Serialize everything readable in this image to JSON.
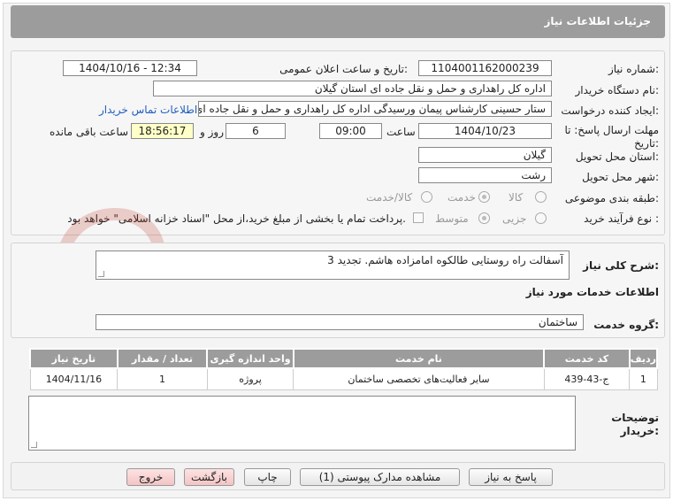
{
  "header": {
    "title": "جزئیات اطلاعات نیاز"
  },
  "form": {
    "need_number_label": "شماره نیاز:",
    "need_number": "1104001162000239",
    "announce_label": "تاریخ و ساعت اعلان عمومی:",
    "announce_value": "1404/10/16 - 12:34",
    "buyer_org_label": "نام دستگاه خریدار:",
    "buyer_org": "اداره کل راهداری و حمل و نقل جاده ای استان گیلان",
    "requester_label": "ایجاد کننده درخواست:",
    "requester": "ستار حسینی کارشناس پیمان ورسیدگی اداره کل راهداری و حمل و نقل جاده ای استان گیلان",
    "contact_link": "اطلاعات تماس خریدار",
    "deadline_label_1": "مهلت ارسال پاسخ: تا",
    "deadline_label_2": "تاریخ:",
    "deadline_date": "1404/10/23",
    "time_label": "ساعت",
    "deadline_time": "09:00",
    "days_value": "6",
    "days_label": "روز و",
    "remaining_time": "18:56:17",
    "remaining_label": "ساعت باقی مانده",
    "province_label": "استان محل تحویل:",
    "province": "گیلان",
    "city_label": "شهر محل تحویل:",
    "city": "رشت",
    "category_label": "طبقه بندی موضوعی:",
    "category_options": [
      "کالا",
      "خدمت",
      "کالا/خدمت"
    ],
    "category_selected": "خدمت",
    "process_label": "نوع فرآیند خرید :",
    "process_options": [
      "جزیی",
      "متوسط"
    ],
    "process_selected": "متوسط",
    "payment_note": "پرداخت تمام یا بخشی از مبلغ خرید،از محل \"اسناد خزانه اسلامی\" خواهد بود."
  },
  "description": {
    "label": "شرح کلی نیاز:",
    "value": "آسفالت راه روستایی طالکوه امامزاده هاشم. تجدید 3"
  },
  "services": {
    "section_title": "اطلاعات خدمات مورد نیاز",
    "group_label": "گروه خدمت:",
    "group_value": "ساختمان",
    "columns": [
      "ردیف",
      "کد خدمت",
      "نام خدمت",
      "واحد اندازه گیری",
      "تعداد / مقدار",
      "تاریخ نیاز"
    ],
    "rows": [
      {
        "index": "1",
        "code": "ج-43-439",
        "name": "سایر فعالیت‌های تخصصی ساختمان",
        "unit": "پروژه",
        "qty": "1",
        "date": "1404/11/16"
      }
    ]
  },
  "buyer_notes": {
    "label_1": "توضیحات",
    "label_2": "خریدار:",
    "value": ""
  },
  "buttons": {
    "reply": "پاسخ به نیاز",
    "attachments": "مشاهده مدارک پیوستی (1)",
    "print": "چاپ",
    "back": "بازگشت",
    "exit": "خروج"
  },
  "watermark": {
    "text": "AriaTender.net"
  },
  "colors": {
    "header": "#9c9c9c",
    "link": "#1f5fbf",
    "watermark": "#c0392b",
    "highlight": "#ffffc8"
  }
}
